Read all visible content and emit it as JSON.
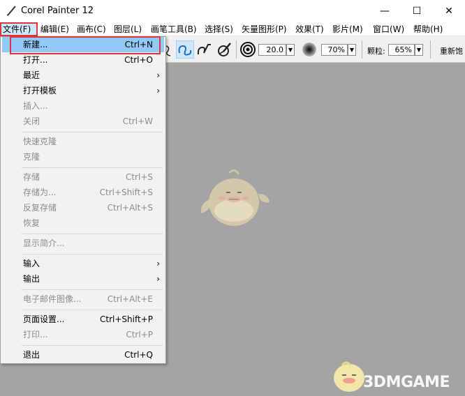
{
  "window": {
    "title": "Corel Painter 12",
    "app_icon": "brush-icon",
    "minimize_glyph": "—",
    "maximize_glyph": "☐",
    "close_glyph": "✕"
  },
  "menubar": [
    {
      "label": "文件(F)"
    },
    {
      "label": "编辑(E)"
    },
    {
      "label": "画布(C)"
    },
    {
      "label": "图层(L)"
    },
    {
      "label": "画笔工具(B)"
    },
    {
      "label": "选择(S)"
    },
    {
      "label": "矢量图形(P)"
    },
    {
      "label": "效果(T)"
    },
    {
      "label": "影片(M)"
    },
    {
      "label": "窗口(W)"
    },
    {
      "label": "帮助(H)"
    }
  ],
  "toolbar": {
    "size_value": "20.0",
    "opacity_value": "70%",
    "grain_label": "颗粒:",
    "grain_value": "65%",
    "resaturate_label": "重新饱",
    "dropdown_glyph": "▼"
  },
  "file_menu": {
    "items": [
      {
        "label": "新建...",
        "shortcut": "Ctrl+N",
        "enabled": true,
        "highlighted": true
      },
      {
        "label": "打开...",
        "shortcut": "Ctrl+O",
        "enabled": true
      },
      {
        "label": "最近",
        "shortcut": "",
        "enabled": true,
        "submenu": true
      },
      {
        "label": "打开模板",
        "shortcut": "",
        "enabled": true,
        "submenu": true
      },
      {
        "label": "插入...",
        "shortcut": "",
        "enabled": false
      },
      {
        "label": "关闭",
        "shortcut": "Ctrl+W",
        "enabled": false
      },
      {
        "label": "快速克隆",
        "shortcut": "",
        "enabled": false
      },
      {
        "label": "克隆",
        "shortcut": "",
        "enabled": false
      },
      {
        "label": "存储",
        "shortcut": "Ctrl+S",
        "enabled": false
      },
      {
        "label": "存储为...",
        "shortcut": "Ctrl+Shift+S",
        "enabled": false
      },
      {
        "label": "反复存储",
        "shortcut": "Ctrl+Alt+S",
        "enabled": false
      },
      {
        "label": "恢复",
        "shortcut": "",
        "enabled": false
      },
      {
        "label": "显示简介...",
        "shortcut": "",
        "enabled": false
      },
      {
        "label": "输入",
        "shortcut": "",
        "enabled": true,
        "submenu": true
      },
      {
        "label": "输出",
        "shortcut": "",
        "enabled": true,
        "submenu": true
      },
      {
        "label": "电子邮件图像...",
        "shortcut": "Ctrl+Alt+E",
        "enabled": false
      },
      {
        "label": "页面设置...",
        "shortcut": "Ctrl+Shift+P",
        "enabled": true
      },
      {
        "label": "打印...",
        "shortcut": "Ctrl+P",
        "enabled": false
      },
      {
        "label": "退出",
        "shortcut": "Ctrl+Q",
        "enabled": true
      }
    ],
    "submenu_glyph": "›"
  },
  "watermark": {
    "text": "3DMGAME"
  },
  "colors": {
    "highlight_border": "#e0333a",
    "hover_bg": "#91c9f7",
    "workspace": "#a4a4a4"
  }
}
